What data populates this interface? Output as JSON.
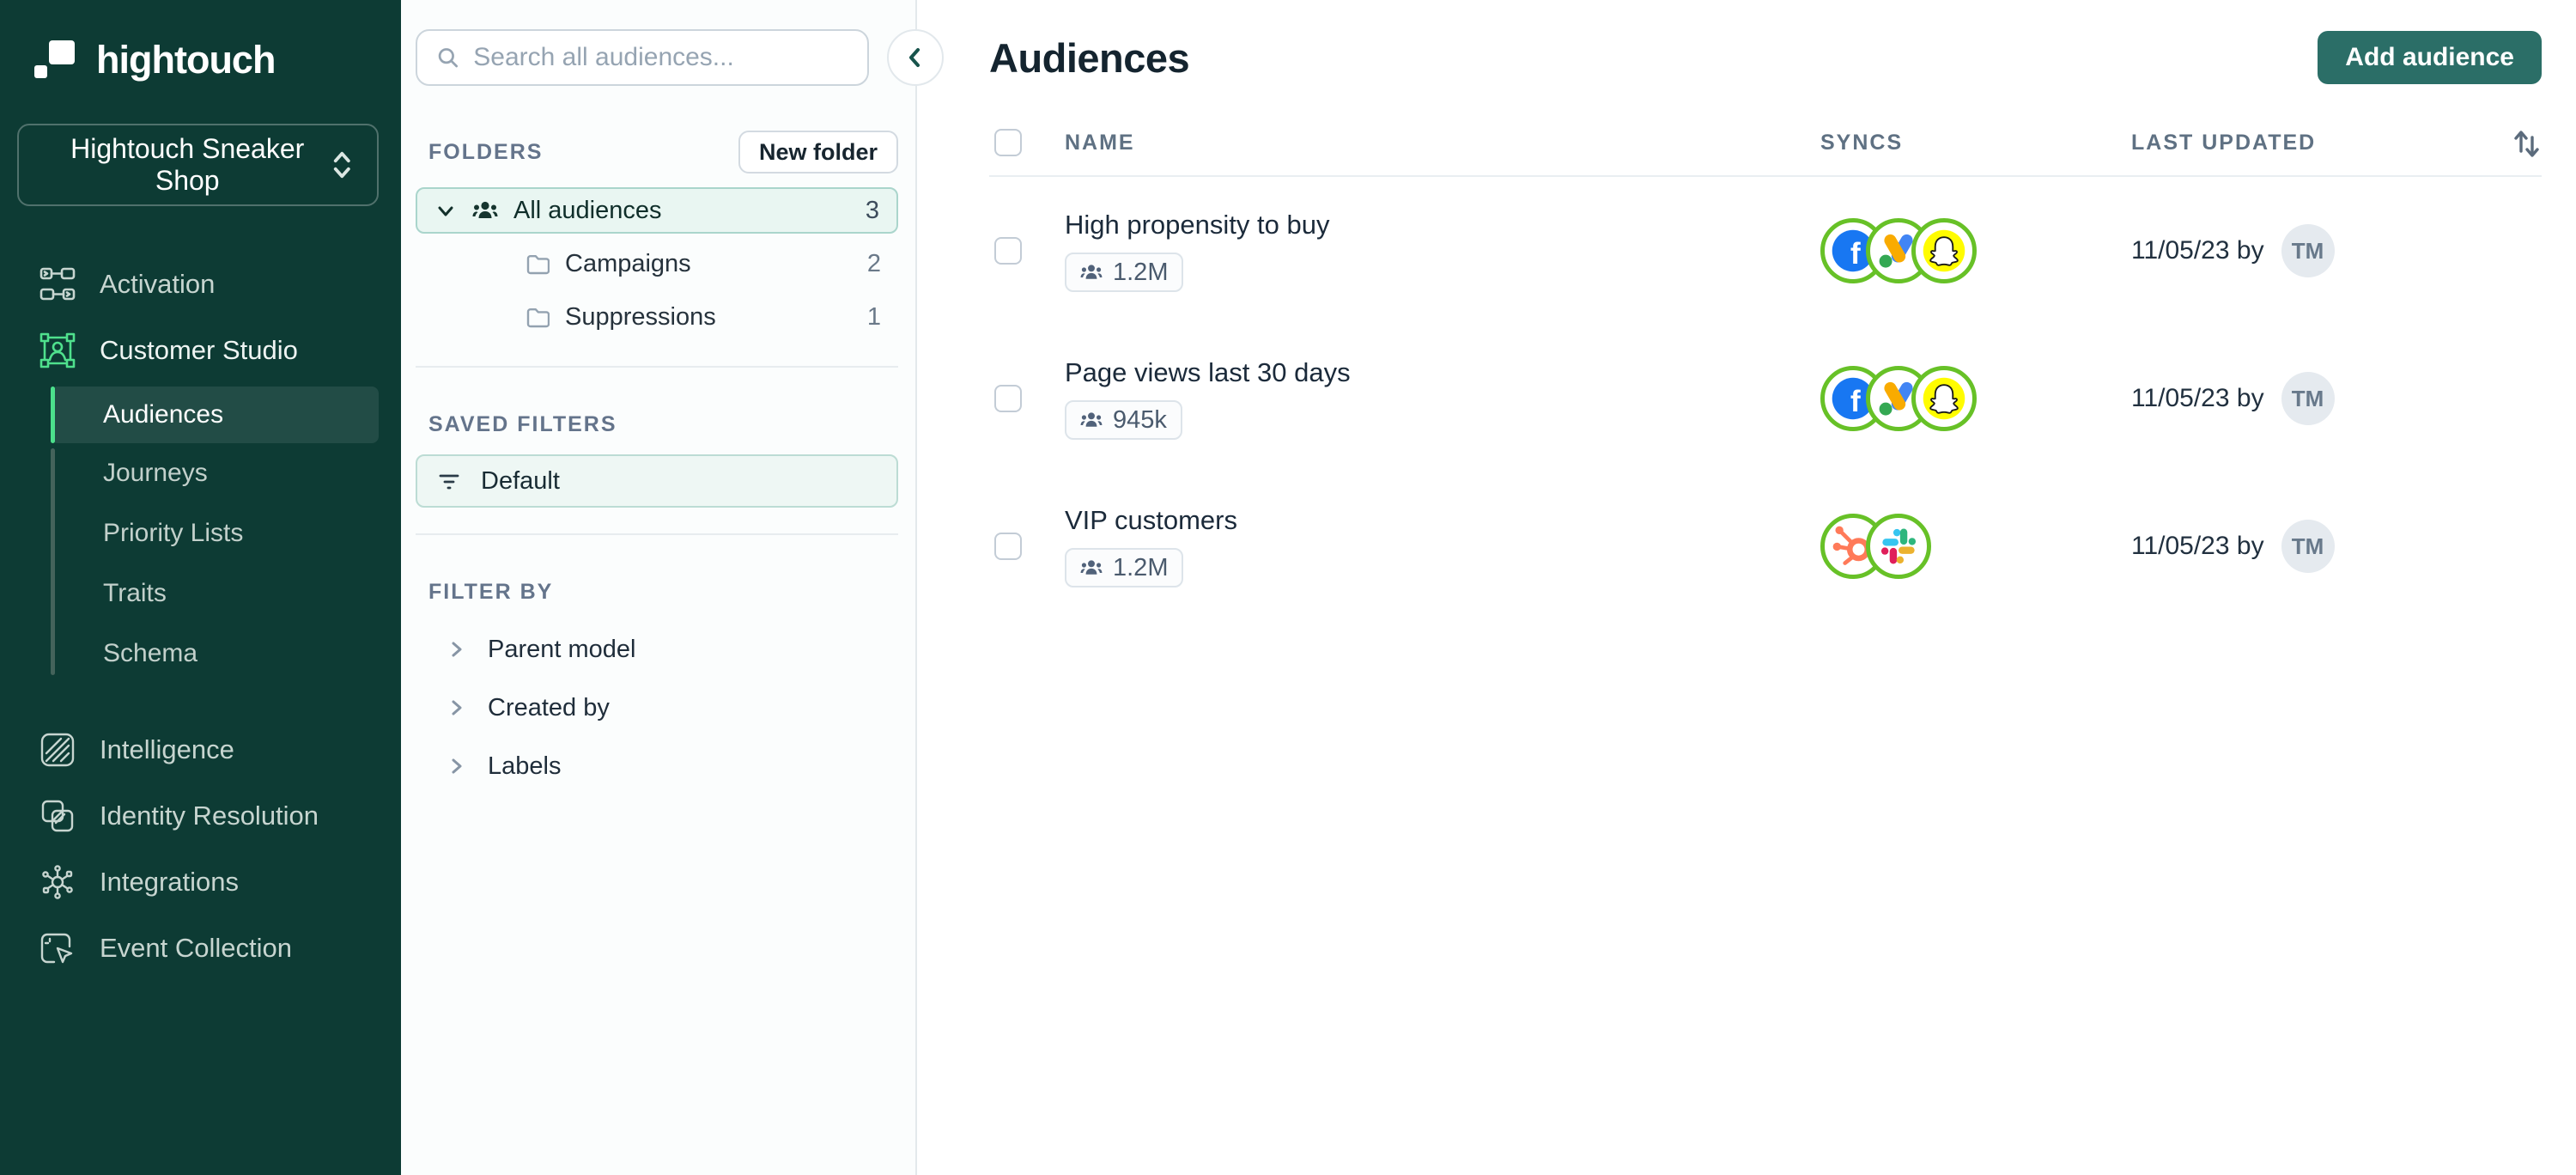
{
  "brand": {
    "logo_text": "hightouch",
    "workspace_name": "Hightouch Sneaker Shop"
  },
  "sidebar": {
    "items": [
      {
        "label": "Activation"
      },
      {
        "label": "Customer Studio"
      }
    ],
    "customer_studio_items": [
      {
        "label": "Audiences",
        "active": true
      },
      {
        "label": "Journeys"
      },
      {
        "label": "Priority Lists"
      },
      {
        "label": "Traits"
      },
      {
        "label": "Schema"
      }
    ],
    "lower_items": [
      {
        "label": "Intelligence"
      },
      {
        "label": "Identity Resolution"
      },
      {
        "label": "Integrations"
      },
      {
        "label": "Event Collection"
      }
    ]
  },
  "panel": {
    "search_placeholder": "Search all audiences...",
    "sections": {
      "folders": "FOLDERS",
      "saved_filters": "SAVED FILTERS",
      "filter_by": "FILTER BY"
    },
    "new_folder_button": "New folder",
    "folders": [
      {
        "name": "All audiences",
        "count": "3",
        "selected": true
      },
      {
        "name": "Campaigns",
        "count": "2"
      },
      {
        "name": "Suppressions",
        "count": "1"
      }
    ],
    "saved_filters": [
      {
        "name": "Default"
      }
    ],
    "filter_by": [
      {
        "label": "Parent model"
      },
      {
        "label": "Created by"
      },
      {
        "label": "Labels"
      }
    ]
  },
  "main": {
    "title": "Audiences",
    "add_audience_button": "Add audience",
    "table": {
      "columns": {
        "name": "NAME",
        "syncs": "SYNCS",
        "last_updated": "LAST UPDATED"
      },
      "rows": [
        {
          "name": "High propensity to buy",
          "size": "1.2M",
          "syncs": [
            "Facebook",
            "Google Ads",
            "Snapchat"
          ],
          "last_updated": "11/05/23 by",
          "avatar_initials": "TM"
        },
        {
          "name": "Page views last 30 days",
          "size": "945k",
          "syncs": [
            "Facebook",
            "Google Ads",
            "Snapchat"
          ],
          "last_updated": "11/05/23 by",
          "avatar_initials": "TM"
        },
        {
          "name": "VIP customers",
          "size": "1.2M",
          "syncs": [
            "HubSpot",
            "Slack"
          ],
          "last_updated": "11/05/23 by",
          "avatar_initials": "TM"
        }
      ]
    }
  },
  "colors": {
    "sidebar_bg": "#0d3b34",
    "accent_green": "#4ce08c",
    "button_teal": "#2b6e67",
    "selected_teal_bg": "#e9f6f2",
    "selected_teal_border": "#aad5cc",
    "sync_ring_green": "#67c127",
    "facebook_blue": "#1877f2",
    "snapchat_yellow": "#fffc00",
    "hubspot_orange": "#ff7a59",
    "slack_blue": "#36c5f0",
    "slack_green": "#2eb67d",
    "slack_red": "#e01e5a",
    "slack_yellow": "#ecb22e",
    "google_blue": "#4285f4",
    "google_yellow": "#f9ab00",
    "google_green": "#34a853"
  }
}
